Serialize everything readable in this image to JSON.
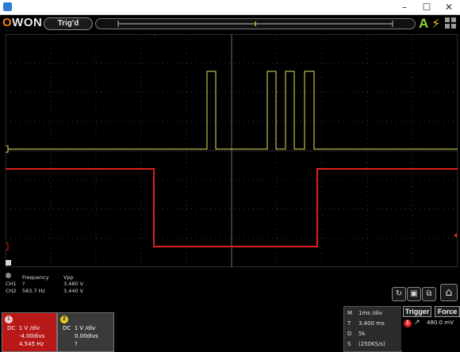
{
  "window": {
    "minimize": "–",
    "maximize": "☐",
    "close": "✕"
  },
  "toolbar": {
    "logo_o": "O",
    "logo_rest": "WON",
    "trigger_state": "Trig'd",
    "run_indicator": "A",
    "power_icon": "lightning-bolt-icon"
  },
  "colors": {
    "ch1": "#e8e05a",
    "ch2": "#e02020",
    "grid": "#3a3a3a",
    "ch1_card": "#b81818",
    "ch2_card": "#3a3a3a",
    "accent": "#f07a12"
  },
  "measure": {
    "head1": "Frequency",
    "head2": "Vpp",
    "ch1_label": "CH1",
    "ch1_freq": "?",
    "ch1_vpp": "3.480 V",
    "ch2_label": "CH2",
    "ch2_freq": "583.7 Hz",
    "ch2_vpp": "3.440 V"
  },
  "ch1": {
    "num": "1",
    "coupling": "DC",
    "volts": "1 V /div",
    "offset": "-4.00divs",
    "freq": "4.545 Hz"
  },
  "ch2": {
    "num": "2",
    "coupling": "DC",
    "volts": "1 V /div",
    "offset": "0.00divs",
    "freq": "?"
  },
  "timebase": {
    "m_key": "M",
    "m_val": "1ms /div",
    "t_key": "T",
    "t_val": "3.400 ms",
    "d_key": "D",
    "d_val": "5k",
    "s_key": "S",
    "s_val": "(250KS/s)"
  },
  "trigger": {
    "label": "Trigger",
    "force": "Force",
    "channel": "1",
    "level": "480.0 mV"
  },
  "icons": {
    "home": "⌂",
    "save": "▣",
    "screen": "⧉",
    "mode": "↻"
  }
}
